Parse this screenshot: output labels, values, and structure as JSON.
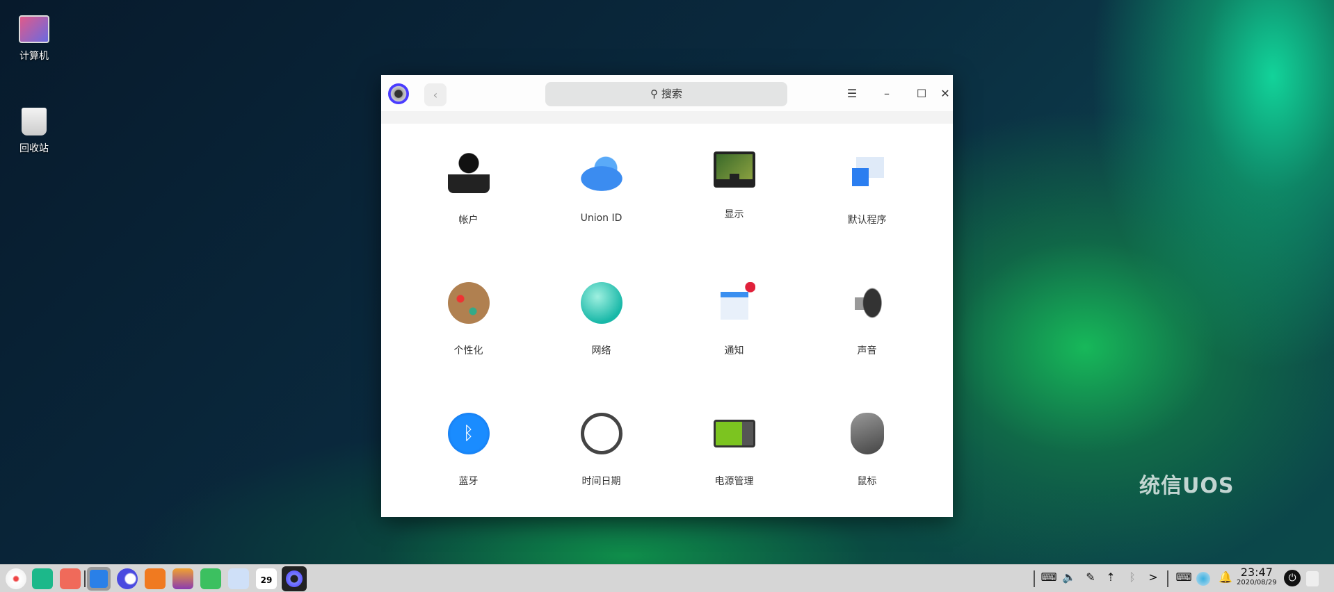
{
  "desktop": {
    "icons": [
      {
        "label": "计算机"
      },
      {
        "label": "回收站"
      }
    ],
    "watermark": "统信UOS"
  },
  "window": {
    "search_placeholder": "搜索",
    "back_icon": "‹",
    "menu_icon": "☰",
    "minimize_icon": "–",
    "maximize_icon": "☐",
    "close_icon": "✕",
    "items": [
      {
        "label": "帐户"
      },
      {
        "label": "Union ID"
      },
      {
        "label": "显示"
      },
      {
        "label": "默认程序"
      },
      {
        "label": "个性化"
      },
      {
        "label": "网络"
      },
      {
        "label": "通知"
      },
      {
        "label": "声音"
      },
      {
        "label": "蓝牙"
      },
      {
        "label": "时间日期"
      },
      {
        "label": "电源管理"
      },
      {
        "label": "鼠标"
      }
    ]
  },
  "taskbar": {
    "calendar_day": "29",
    "time": "23:47",
    "date": "2020/08/29",
    "more_icon": ">"
  }
}
